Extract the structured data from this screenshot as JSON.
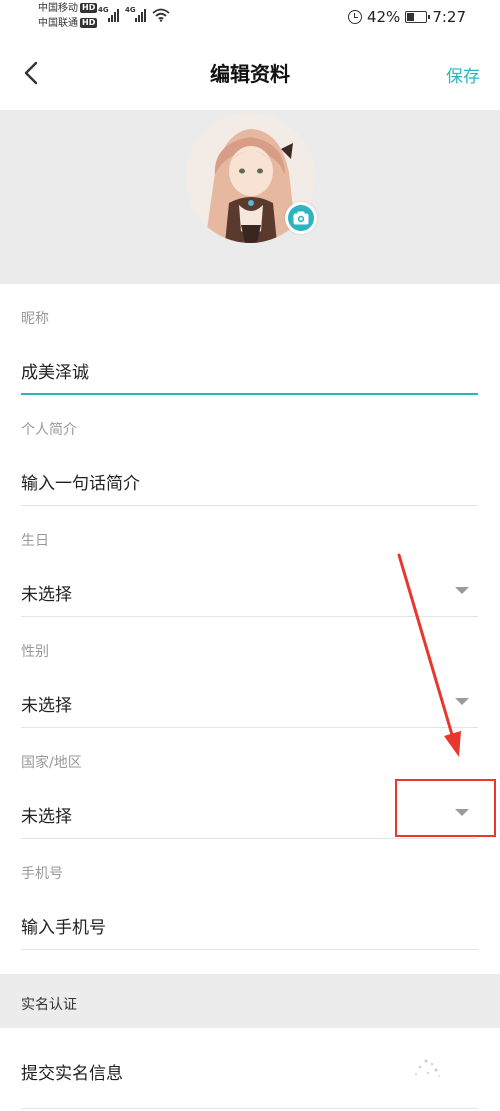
{
  "status_bar": {
    "carrier1": "中国移动",
    "carrier2": "中国联通",
    "hd": "HD",
    "net1": "4G",
    "net2": "4G",
    "battery_percent": "42%",
    "battery_level": 0.42,
    "time": "7:27"
  },
  "nav": {
    "title": "编辑资料",
    "save_label": "保存",
    "back_icon": "chevron-left-icon"
  },
  "avatar": {
    "camera_icon": "camera-icon"
  },
  "form": {
    "nickname": {
      "label": "昵称",
      "value": "成美泽诚"
    },
    "bio": {
      "label": "个人简介",
      "placeholder": "输入一句话简介"
    },
    "birthday": {
      "label": "生日",
      "value": "未选择"
    },
    "gender": {
      "label": "性别",
      "value": "未选择"
    },
    "region": {
      "label": "国家/地区",
      "value": "未选择"
    },
    "phone": {
      "label": "手机号",
      "placeholder": "输入手机号"
    }
  },
  "real_name": {
    "section_title": "实名认证",
    "item_label": "提交实名信息"
  },
  "colors": {
    "accent": "#2cb5c0",
    "annotation": "#e8372d",
    "section_bg": "#ececec"
  }
}
